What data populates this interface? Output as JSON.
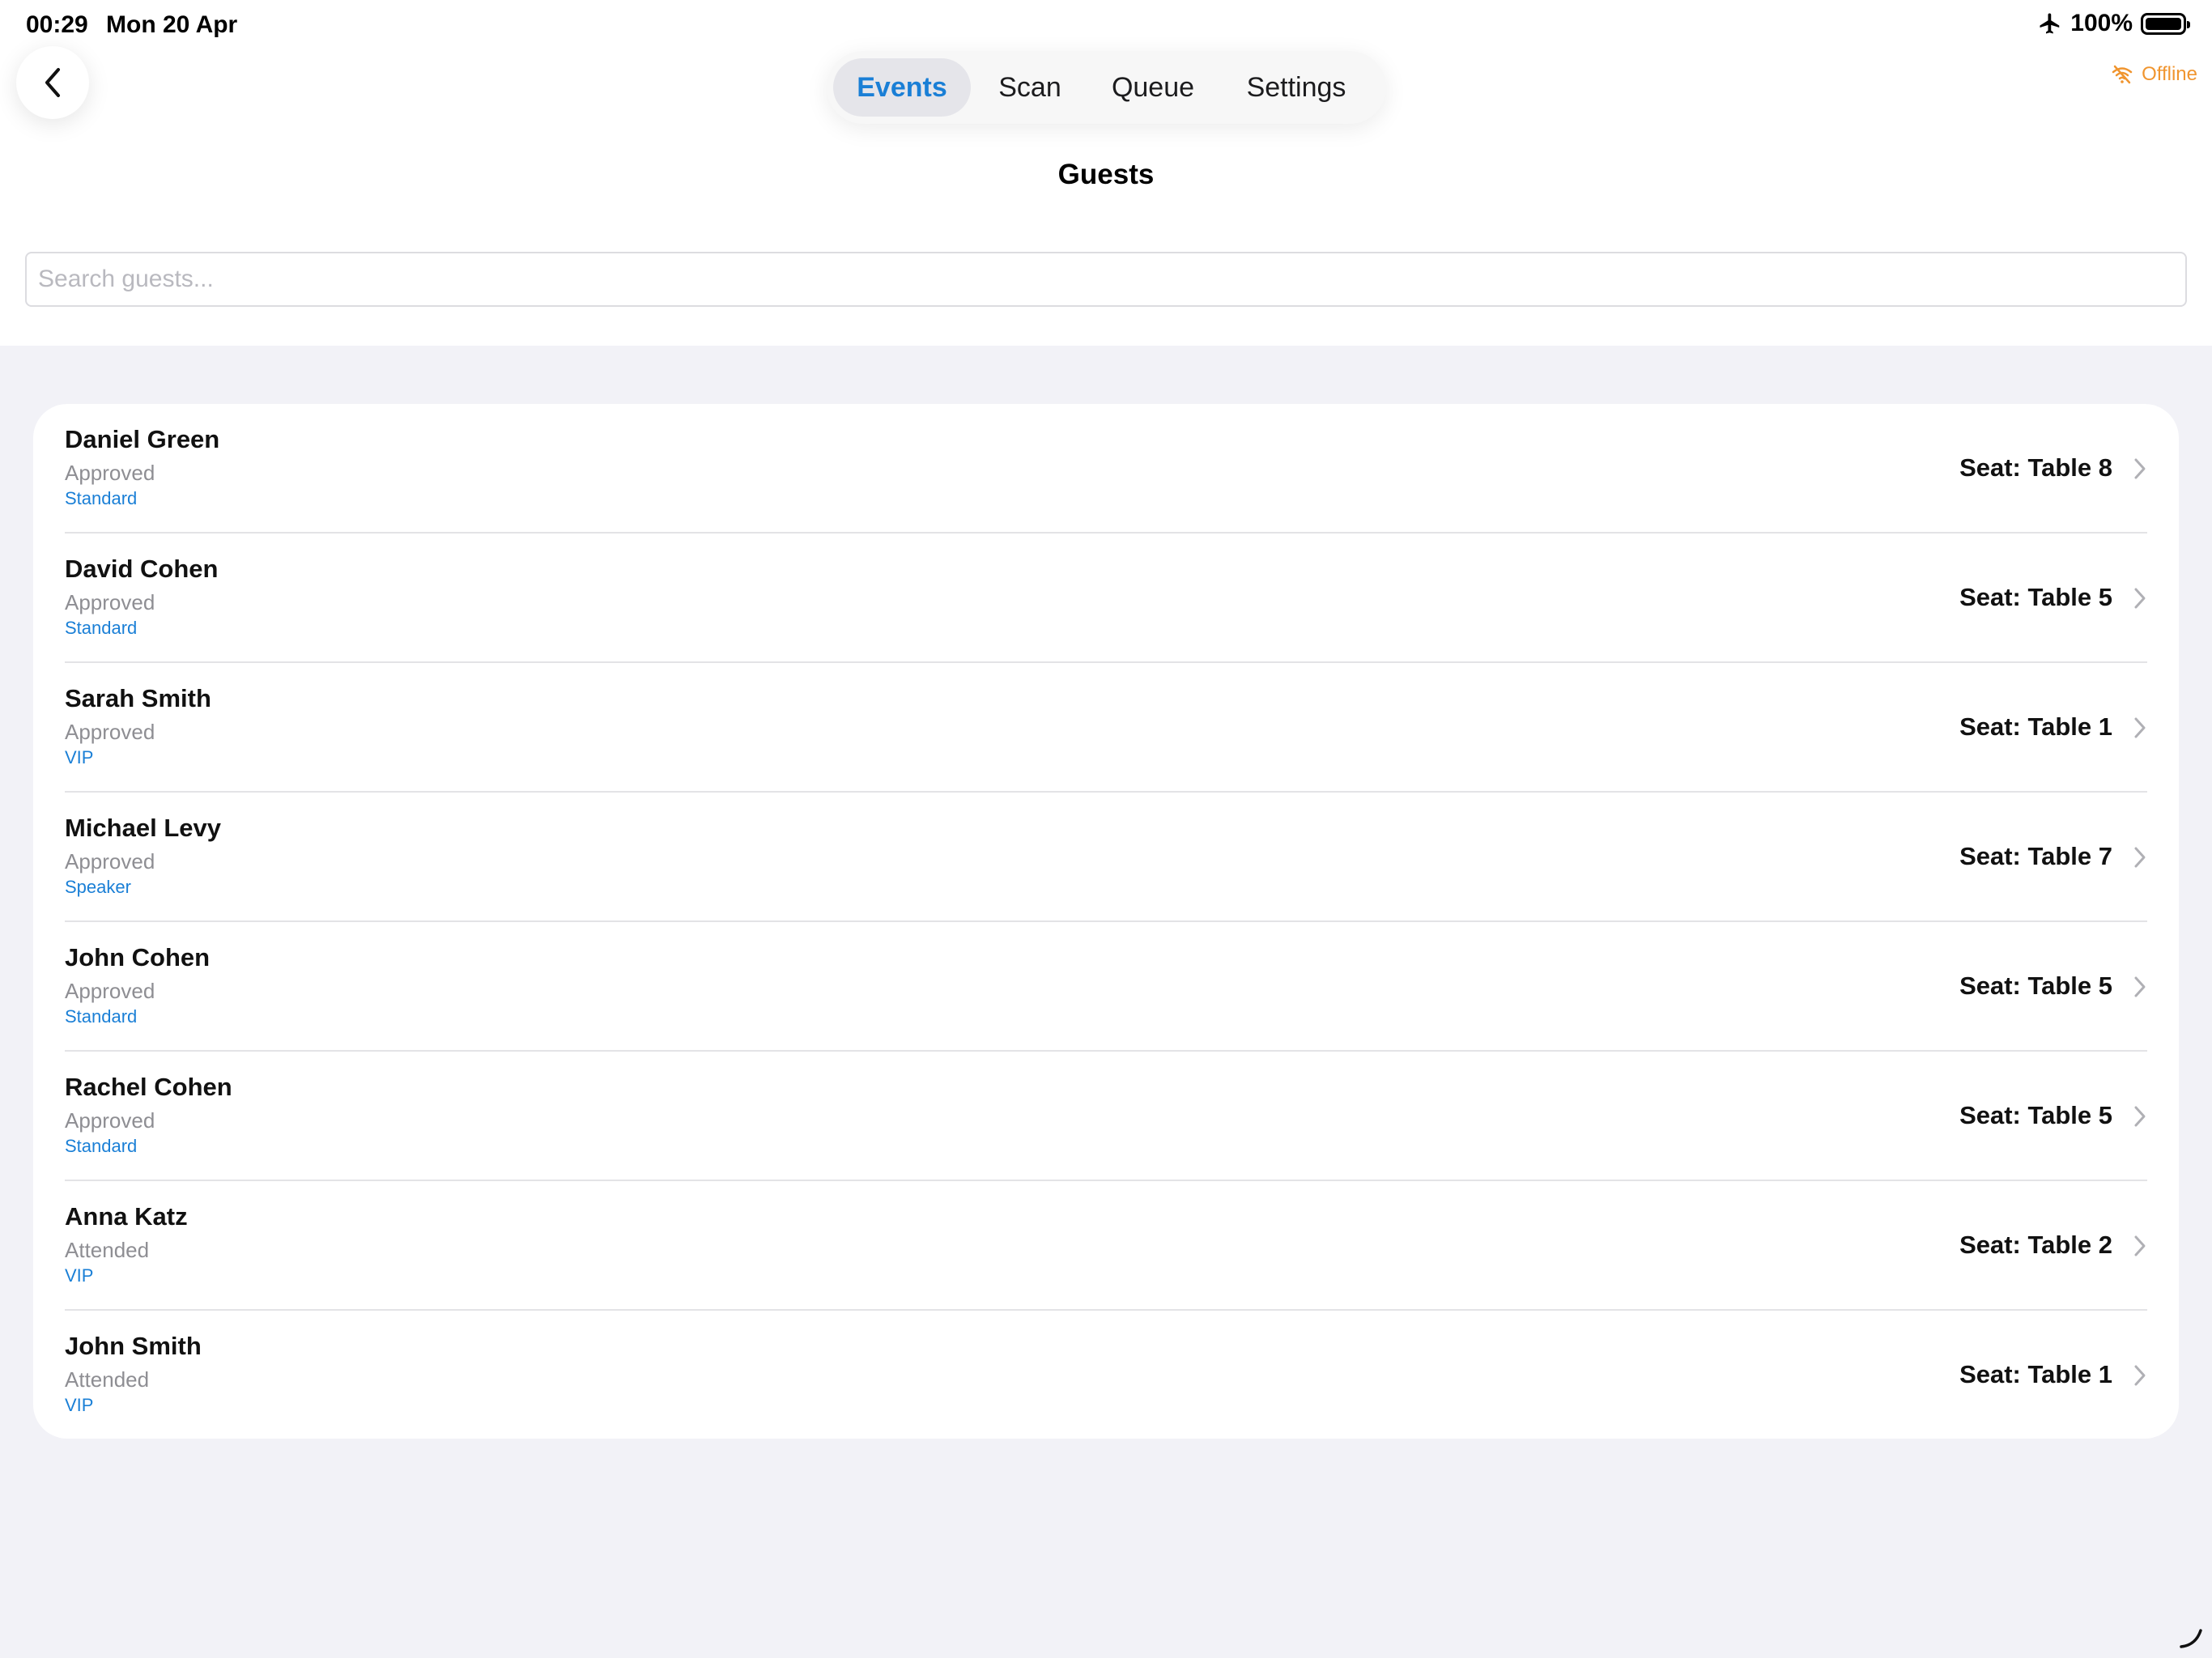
{
  "status_bar": {
    "time": "00:29",
    "date": "Mon 20 Apr",
    "battery": "100%"
  },
  "nav": {
    "tabs": [
      {
        "label": "Events",
        "active": true
      },
      {
        "label": "Scan",
        "active": false
      },
      {
        "label": "Queue",
        "active": false
      },
      {
        "label": "Settings",
        "active": false
      }
    ],
    "offline_label": "Offline"
  },
  "page": {
    "title": "Guests"
  },
  "search": {
    "placeholder": "Search guests...",
    "value": ""
  },
  "guests": [
    {
      "name": "Daniel Green",
      "status": "Approved",
      "type": "Standard",
      "seat": "Seat: Table 8"
    },
    {
      "name": "David Cohen",
      "status": "Approved",
      "type": "Standard",
      "seat": "Seat: Table 5"
    },
    {
      "name": "Sarah Smith",
      "status": "Approved",
      "type": "VIP",
      "seat": "Seat: Table 1"
    },
    {
      "name": "Michael Levy",
      "status": "Approved",
      "type": "Speaker",
      "seat": "Seat: Table 7"
    },
    {
      "name": "John Cohen",
      "status": "Approved",
      "type": "Standard",
      "seat": "Seat: Table 5"
    },
    {
      "name": "Rachel Cohen",
      "status": "Approved",
      "type": "Standard",
      "seat": "Seat: Table 5"
    },
    {
      "name": "Anna Katz",
      "status": "Attended",
      "type": "VIP",
      "seat": "Seat: Table 2"
    },
    {
      "name": "John Smith",
      "status": "Attended",
      "type": "VIP",
      "seat": "Seat: Table 1"
    }
  ],
  "colors": {
    "accent": "#1a7fd6",
    "offline": "#f0952f",
    "background": "#f2f2f7",
    "secondary_text": "#8e8e93"
  },
  "icons": {
    "back": "chevron-left-icon",
    "status_airplane": "airplane-icon",
    "status_battery": "battery-icon",
    "offline": "wifi-off-icon",
    "row": "chevron-right-icon"
  }
}
